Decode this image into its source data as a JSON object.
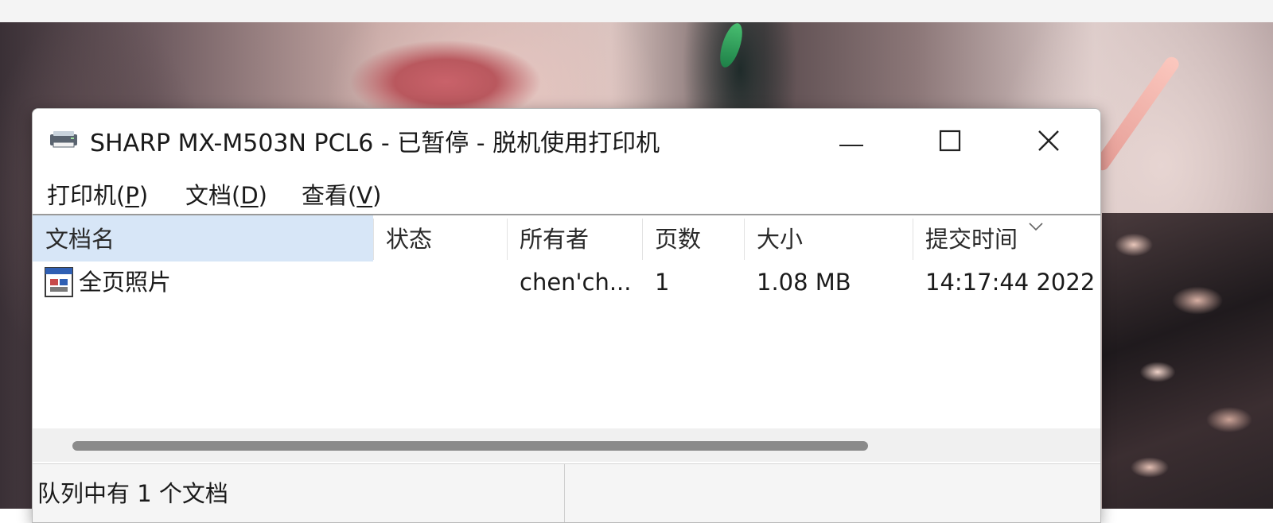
{
  "window": {
    "title": "SHARP MX-M503N PCL6 - 已暂停  -  脱机使用打印机",
    "title_icon": "printer-icon",
    "controls": {
      "minimize": "minimize-icon",
      "maximize": "maximize-icon",
      "close": "close-icon"
    }
  },
  "menu": [
    {
      "label": "打印机(",
      "key": "P",
      "suffix": ")"
    },
    {
      "label": "文档(",
      "key": "D",
      "suffix": ")"
    },
    {
      "label": "查看(",
      "key": "V",
      "suffix": ")"
    }
  ],
  "columns": [
    "文档名",
    "状态",
    "所有者",
    "页数",
    "大小",
    "提交时间"
  ],
  "sorted_column_icon": "chevron-down-icon",
  "rows": [
    {
      "icon": "document-icon",
      "name": "全页照片",
      "status": "",
      "owner": "chen'ch...",
      "pages": "1",
      "size": "1.08 MB",
      "submitted": "14:17:44  2022"
    }
  ],
  "status": {
    "text": "队列中有 1 个文档"
  },
  "colors": {
    "header_active": "#d7e6f7",
    "scroll_thumb": "#8a8a8a"
  }
}
